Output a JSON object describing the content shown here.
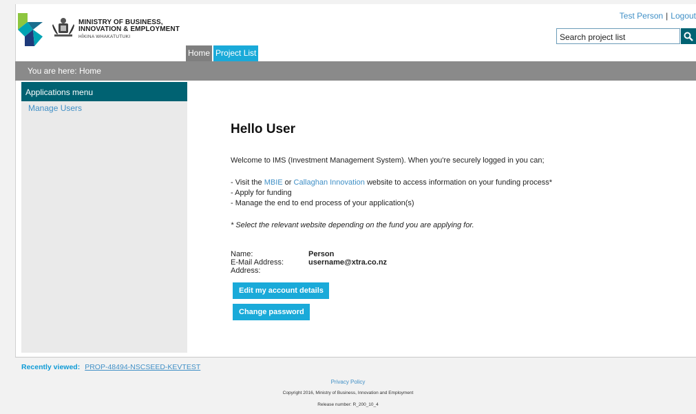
{
  "header": {
    "ministry_line1": "MINISTRY OF BUSINESS,",
    "ministry_line2": "INNOVATION & EMPLOYMENT",
    "ministry_line3": "HĪKINA WHAKATUTUKI",
    "user_name": "Test Person",
    "separator": "|",
    "logout_label": "Logout",
    "search_value": "Search project list",
    "search_icon": "search-icon"
  },
  "tabs": [
    {
      "label": "Home"
    },
    {
      "label": "Project List"
    }
  ],
  "breadcrumb": "You are here: Home",
  "sidebar": {
    "heading": "Applications menu",
    "items": [
      {
        "label": "Manage Users"
      }
    ]
  },
  "main": {
    "title": "Hello User",
    "welcome": "Welcome to IMS (Investment Management System). When you're securely logged in you can;",
    "bullet1_pre": "- Visit the ",
    "bullet1_link1": "MBIE",
    "bullet1_mid": " or ",
    "bullet1_link2": "Callaghan Innovation",
    "bullet1_post": " website to access information on your funding process*",
    "bullet2": "- Apply for funding",
    "bullet3": "- Manage the end to end process of your application(s)",
    "note": "* Select the relevant website depending on the fund you are applying for.",
    "details": [
      {
        "label": "Name:",
        "value": "Person"
      },
      {
        "label": "E-Mail Address:",
        "value": "username@xtra.co.nz"
      },
      {
        "label": "Address:",
        "value": ""
      }
    ],
    "edit_button": "Edit my account details",
    "password_button": "Change password"
  },
  "footer": {
    "recent_label": "Recently viewed:",
    "recent_link": "PROP-48494-NSCSEED-KEVTEST",
    "privacy": "Privacy Policy",
    "copyright": "Copyright 2016, Ministry of Business, Innovation and Employment",
    "release": "Release number: R_200_10_4"
  },
  "colors": {
    "accent_teal": "#006272",
    "accent_blue": "#1aaad9",
    "link": "#3f8fc6",
    "breadcrumb_bg": "#8a8a8a"
  }
}
